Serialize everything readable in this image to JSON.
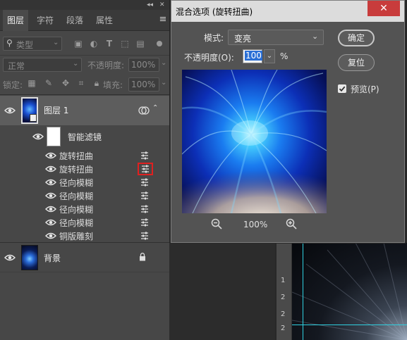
{
  "layers_panel": {
    "tabs": [
      "图层",
      "字符",
      "段落",
      "属性"
    ],
    "active_tab": 0,
    "filter_kind": "类型",
    "blend_mode": "正常",
    "opacity_label": "不透明度:",
    "opacity_value": "100%",
    "lock_label": "锁定:",
    "fill_label": "填充:",
    "fill_value": "100%",
    "layer1_name": "图层 1",
    "smart_filter_label": "智能滤镜",
    "filters": [
      "旋转扭曲",
      "旋转扭曲",
      "径向模糊",
      "径向模糊",
      "径向模糊",
      "径向模糊",
      "铜版雕刻"
    ],
    "highlighted_filter_index": 1,
    "background_layer_name": "背景"
  },
  "dialog": {
    "title": "混合选项 (旋转扭曲)",
    "mode_label": "模式:",
    "mode_value": "变亮",
    "opacity_label": "不透明度(O):",
    "opacity_value": "100",
    "opacity_unit": "%",
    "ok_label": "确定",
    "reset_label": "复位",
    "preview_label": "预览(P)",
    "preview_checked": true,
    "zoom_value": "100%",
    "close_glyph": "✕"
  },
  "canvas": {
    "ruler_labels": [
      "1",
      "2",
      "2",
      "2"
    ]
  },
  "colors": {
    "panel_bg": "#474747",
    "dialog_bg": "#535353",
    "accent_blue": "#2a9bff",
    "highlight_red": "#e02020",
    "guide_cyan": "#2fd0e0"
  }
}
